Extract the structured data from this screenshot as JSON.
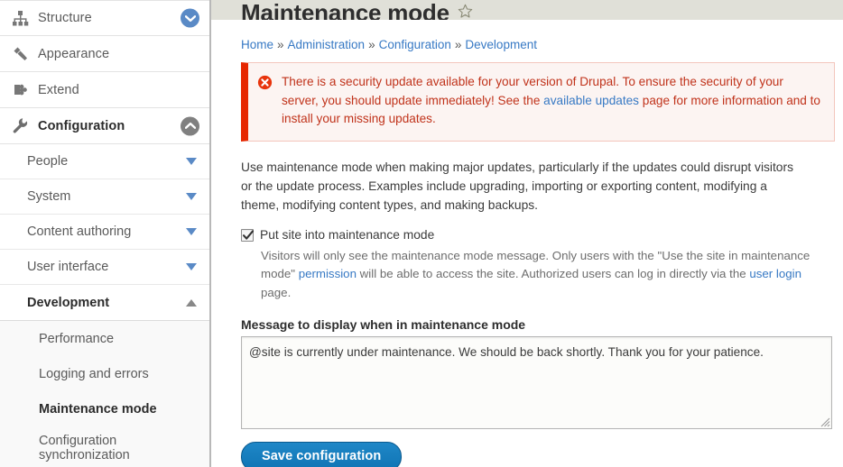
{
  "header": {
    "title": "Maintenance mode",
    "favorite_icon": "star-outline-icon"
  },
  "breadcrumb": {
    "items": [
      {
        "label": "Home",
        "link": true
      },
      {
        "label": "Administration",
        "link": true
      },
      {
        "label": "Configuration",
        "link": true
      },
      {
        "label": "Development",
        "link": true
      }
    ],
    "separator": "»"
  },
  "message": {
    "type": "error",
    "icon": "error-circle-x-icon",
    "accent_color": "#e62600",
    "background_color": "#fcf4f2",
    "text_color": "#c0321a",
    "text_part_1": "There is a security update available for your version of Drupal. To ensure the security of your server, you should update immediately! See the ",
    "link_label": "available updates",
    "text_part_2": " page for more information and to install your missing updates."
  },
  "main": {
    "intro": "Use maintenance mode when making major updates, particularly if the updates could disrupt visitors or the update process. Examples include upgrading, importing or exporting content, modifying a theme, modifying content types, and making backups.",
    "checkbox": {
      "label": "Put site into maintenance mode",
      "checked": true
    },
    "checkbox_description_part_1": "Visitors will only see the maintenance mode message. Only users with the \"Use the site in maintenance mode\" ",
    "checkbox_description_link_1": "permission",
    "checkbox_description_part_2": " will be able to access the site. Authorized users can log in directly via the ",
    "checkbox_description_link_2": "user login",
    "checkbox_description_part_3": " page.",
    "message_field": {
      "label": "Message to display when in maintenance mode",
      "value": "@site is currently under maintenance. We should be back shortly. Thank you for your patience.",
      "placeholder": ""
    },
    "save_button": "Save configuration"
  },
  "sidebar": {
    "top_items": [
      {
        "label": "Structure",
        "icon": "sitemap-icon",
        "toggle": "chevron-down-circle-icon",
        "toggle_color": "blue",
        "active": false
      },
      {
        "label": "Appearance",
        "icon": "paintbrush-icon",
        "toggle": null,
        "toggle_color": null,
        "active": false
      },
      {
        "label": "Extend",
        "icon": "puzzle-piece-icon",
        "toggle": null,
        "toggle_color": null,
        "active": false
      },
      {
        "label": "Configuration",
        "icon": "wrench-icon",
        "toggle": "chevron-up-circle-icon",
        "toggle_color": "gray",
        "active": true
      }
    ],
    "config_children": [
      {
        "label": "People",
        "marker": "triangle-down-icon",
        "marker_color": "blue",
        "active": false
      },
      {
        "label": "System",
        "marker": "triangle-down-icon",
        "marker_color": "blue",
        "active": false
      },
      {
        "label": "Content authoring",
        "marker": "triangle-down-icon",
        "marker_color": "blue",
        "active": false
      },
      {
        "label": "User interface",
        "marker": "triangle-down-icon",
        "marker_color": "blue",
        "active": false
      },
      {
        "label": "Development",
        "marker": "triangle-up-icon",
        "marker_color": "gray",
        "active": true
      }
    ],
    "development_children": [
      {
        "label": "Performance",
        "active": false
      },
      {
        "label": "Logging and errors",
        "active": false
      },
      {
        "label": "Maintenance mode",
        "active": true
      },
      {
        "label": "Configuration synchronization",
        "active": false
      }
    ]
  },
  "colors": {
    "link": "#3779c4",
    "toggle_blue": "#5a8ac6",
    "toggle_gray": "#808080",
    "header_bg": "#e0e0d8",
    "button_blue": "#0f74b4",
    "error_red": "#e62600"
  }
}
